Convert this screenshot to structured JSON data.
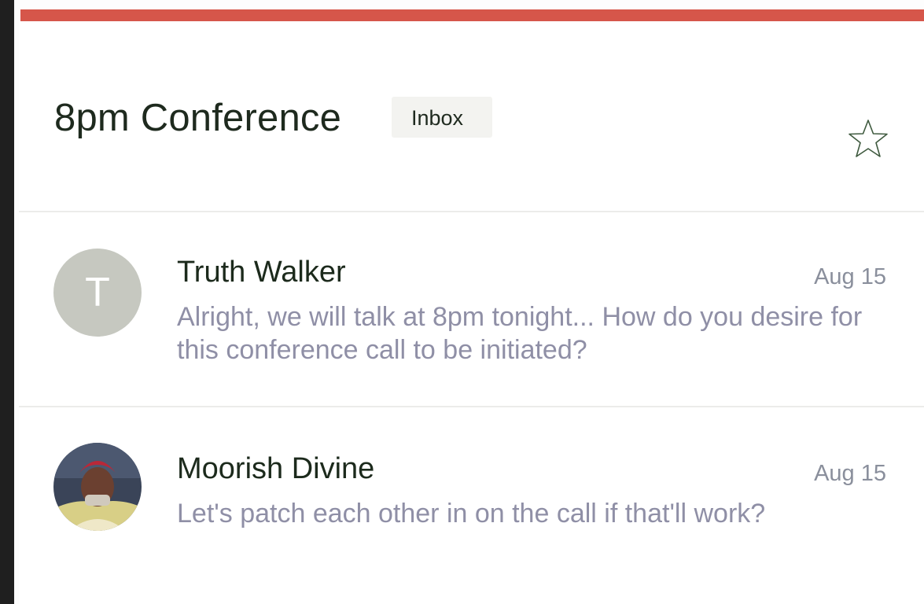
{
  "thread": {
    "title": "8pm Conference",
    "label": "Inbox",
    "star_icon": "star-outline-icon"
  },
  "messages": [
    {
      "sender": "Truth Walker",
      "avatar_letter": "T",
      "date": "Aug 15",
      "snippet": "Alright, we will talk at 8pm tonight... How do you desire for this conference call to be initiated?"
    },
    {
      "sender": "Moorish Divine",
      "avatar_type": "photo",
      "date": "Aug 15",
      "snippet": "Let's patch each other in on the call if that'll work?"
    }
  ],
  "colors": {
    "accent": "#d6564a",
    "sender_text": "#1c2a1c",
    "snippet_text": "#8f8fa6",
    "date_text": "#8a8f9c",
    "avatar_letter_bg": "#c6c8c0"
  }
}
